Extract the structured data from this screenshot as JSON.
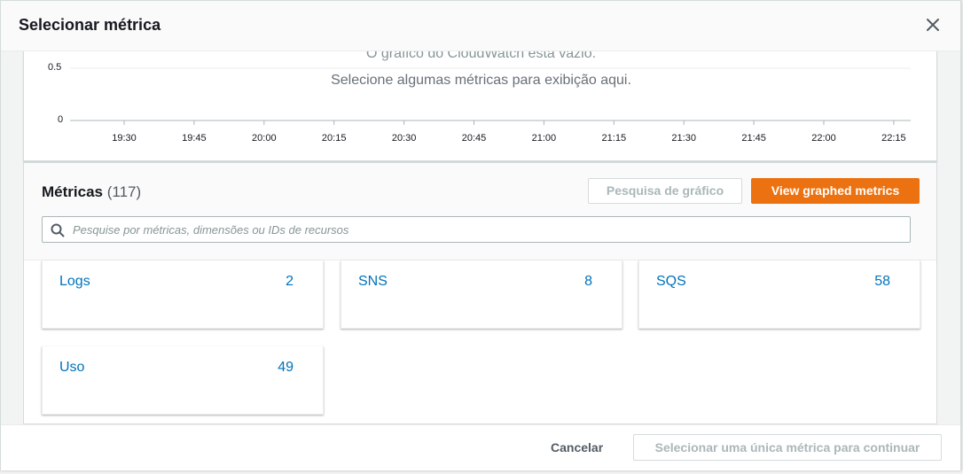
{
  "modal": {
    "title": "Selecionar métrica"
  },
  "graph": {
    "empty_title": "O gráfico do CloudWatch está vazio.",
    "empty_message": "Selecione algumas métricas para exibição aqui."
  },
  "chart_data": {
    "type": "line",
    "x_ticks": [
      "19:30",
      "19:45",
      "20:00",
      "20:15",
      "20:30",
      "20:45",
      "21:00",
      "21:15",
      "21:30",
      "21:45",
      "22:00",
      "22:15"
    ],
    "y_ticks": [
      "0.5",
      "0"
    ],
    "series": [],
    "grid": true
  },
  "metrics": {
    "title": "Métricas",
    "count": "(117)",
    "search_graph_label": "Pesquisa de gráfico",
    "view_graphed_label": "View graphed metrics",
    "search_placeholder": "Pesquise por métricas, dimensões ou IDs de recursos",
    "namespaces": [
      {
        "name": "Logs",
        "count": "2"
      },
      {
        "name": "SNS",
        "count": "8"
      },
      {
        "name": "SQS",
        "count": "58"
      },
      {
        "name": "Uso",
        "count": "49"
      }
    ]
  },
  "footer": {
    "cancel_label": "Cancelar",
    "continue_label": "Selecionar uma única métrica para continuar"
  },
  "colors": {
    "accent": "#ec7211",
    "link": "#0073bb"
  },
  "icons": {
    "close": "close-icon",
    "search": "search-icon",
    "drag": "drag-handle-icon"
  }
}
